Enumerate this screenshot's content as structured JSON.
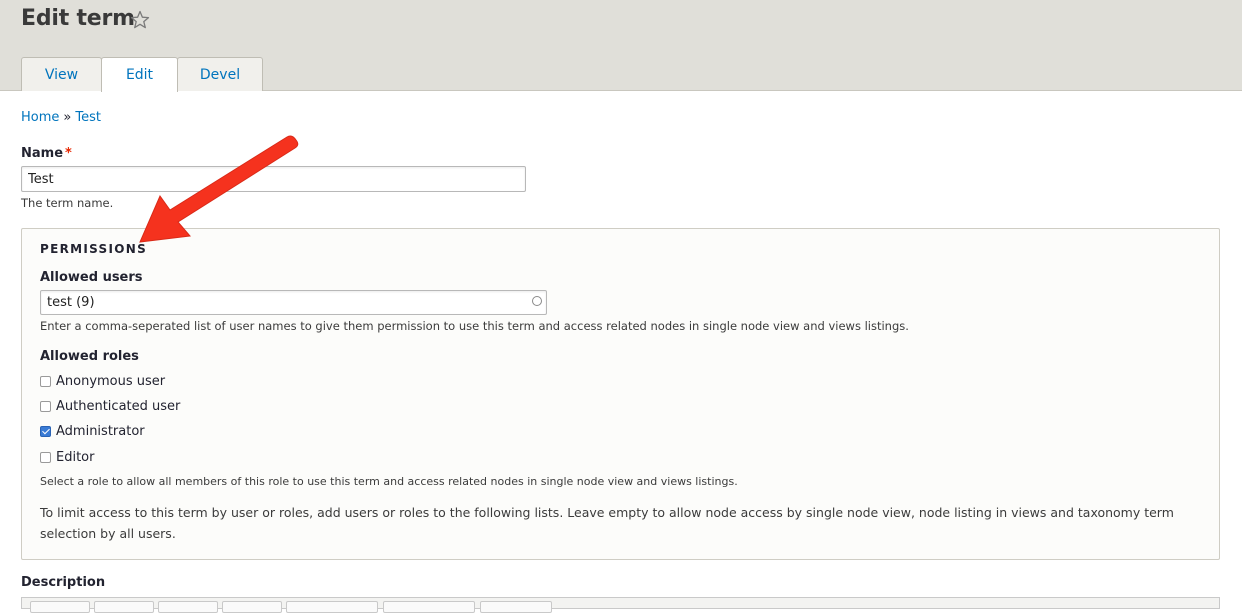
{
  "header": {
    "title": "Edit term",
    "tabs": [
      {
        "label": "View"
      },
      {
        "label": "Edit",
        "active": true
      },
      {
        "label": "Devel"
      }
    ]
  },
  "breadcrumb": {
    "home": "Home",
    "separator": "»",
    "current": "Test"
  },
  "name_field": {
    "label": "Name",
    "required_marker": "*",
    "value": "Test",
    "description": "The term name."
  },
  "permissions": {
    "legend": "PERMISSIONS",
    "allowed_users": {
      "label": "Allowed users",
      "value": "test (9)",
      "description": "Enter a comma-seperated list of user names to give them permission to use this term and access related nodes in single node view and views listings."
    },
    "allowed_roles": {
      "label": "Allowed roles",
      "roles": [
        {
          "label": "Anonymous user",
          "checked": false
        },
        {
          "label": "Authenticated user",
          "checked": false
        },
        {
          "label": "Administrator",
          "checked": true
        },
        {
          "label": "Editor",
          "checked": false
        }
      ],
      "description": "Select a role to allow all members of this role to use this term and access related nodes in single node view and views listings."
    },
    "limit_text": "To limit access to this term by user or roles, add users or roles to the following lists. Leave empty to allow node access by single node view, node listing in views and taxonomy term selection by all users."
  },
  "description_field": {
    "label": "Description"
  },
  "colors": {
    "link": "#0074bd",
    "header_bg": "#e0dfd9",
    "required": "#e62600",
    "annotation_arrow": "#f5321e",
    "checkbox_checked": "#3a7bd5"
  },
  "icons": {
    "favorite": "star-outline-icon",
    "autocomplete": "autocomplete-throbber-icon",
    "annotation": "red-arrow-annotation"
  }
}
